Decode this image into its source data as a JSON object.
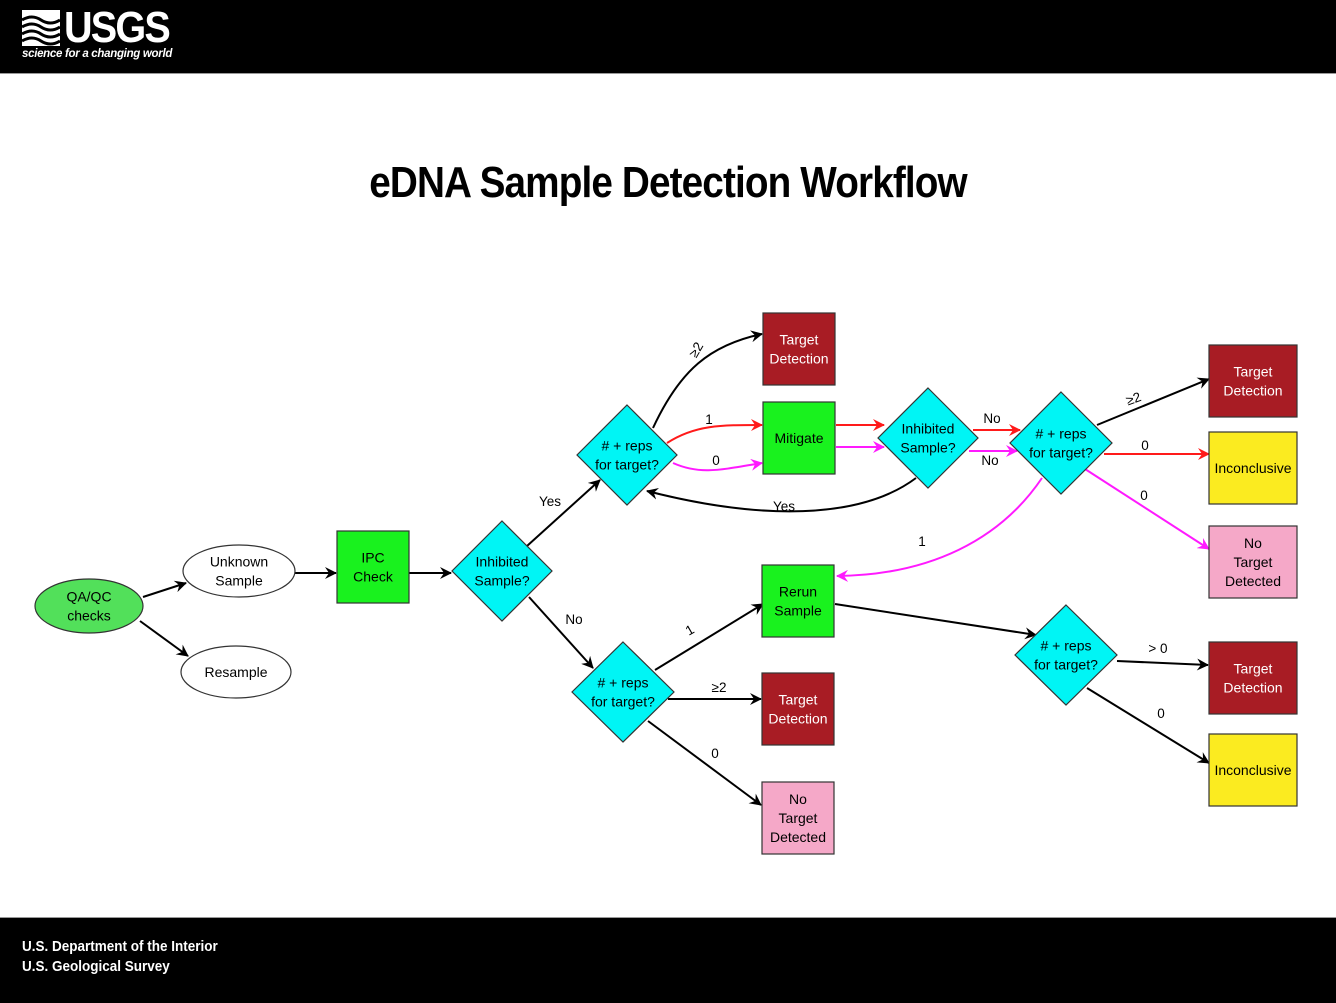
{
  "header": {
    "logo_text": "USGS",
    "tagline": "science for a changing world"
  },
  "title": "eDNA Sample Detection Workflow",
  "footer": {
    "line1": "U.S. Department of the Interior",
    "line2": "U.S. Geological Survey"
  },
  "colors": {
    "start": "#52e05a",
    "process": "#19f21e",
    "decision": "#00f5f5",
    "detection": "#a81c24",
    "inconclusive": "#fbeb20",
    "no_detection": "#f5a8c8",
    "edge_black": "#000000",
    "edge_red": "#ff1a1a",
    "edge_magenta": "#ff1aff"
  },
  "nodes": [
    {
      "id": "qaqc",
      "shape": "ellipse",
      "type": "start",
      "lines": [
        "QA/QC",
        "checks"
      ]
    },
    {
      "id": "unknown",
      "shape": "ellipse",
      "type": "plain",
      "lines": [
        "Unknown",
        "Sample"
      ]
    },
    {
      "id": "resample",
      "shape": "ellipse",
      "type": "plain",
      "lines": [
        "Resample"
      ]
    },
    {
      "id": "ipc",
      "shape": "rect",
      "type": "process",
      "lines": [
        "IPC",
        "Check"
      ]
    },
    {
      "id": "inhib1",
      "shape": "diamond",
      "type": "decision",
      "lines": [
        "Inhibited",
        "Sample?"
      ]
    },
    {
      "id": "reps1",
      "shape": "diamond",
      "type": "decision",
      "lines": [
        "# + reps",
        "for target?"
      ]
    },
    {
      "id": "td1",
      "shape": "rect",
      "type": "detection",
      "lines": [
        "Target",
        "Detection"
      ]
    },
    {
      "id": "mitigate",
      "shape": "rect",
      "type": "process",
      "lines": [
        "Mitigate"
      ]
    },
    {
      "id": "inhib2",
      "shape": "diamond",
      "type": "decision",
      "lines": [
        "Inhibited",
        "Sample?"
      ]
    },
    {
      "id": "reps2",
      "shape": "diamond",
      "type": "decision",
      "lines": [
        "# + reps",
        "for target?"
      ]
    },
    {
      "id": "td2",
      "shape": "rect",
      "type": "detection",
      "lines": [
        "Target",
        "Detection"
      ]
    },
    {
      "id": "inc1",
      "shape": "rect",
      "type": "inconclusive",
      "lines": [
        "Inconclusive"
      ]
    },
    {
      "id": "ntd1",
      "shape": "rect",
      "type": "no_detection",
      "lines": [
        "No",
        "Target",
        "Detected"
      ]
    },
    {
      "id": "reps3",
      "shape": "diamond",
      "type": "decision",
      "lines": [
        "# + reps",
        "for target?"
      ]
    },
    {
      "id": "rerun",
      "shape": "rect",
      "type": "process",
      "lines": [
        "Rerun",
        "Sample"
      ]
    },
    {
      "id": "td3",
      "shape": "rect",
      "type": "detection",
      "lines": [
        "Target",
        "Detection"
      ]
    },
    {
      "id": "ntd2",
      "shape": "rect",
      "type": "no_detection",
      "lines": [
        "No",
        "Target",
        "Detected"
      ]
    },
    {
      "id": "reps4",
      "shape": "diamond",
      "type": "decision",
      "lines": [
        "# + reps",
        "for target?"
      ]
    },
    {
      "id": "td4",
      "shape": "rect",
      "type": "detection",
      "lines": [
        "Target",
        "Detection"
      ]
    },
    {
      "id": "inc2",
      "shape": "rect",
      "type": "inconclusive",
      "lines": [
        "Inconclusive"
      ]
    }
  ],
  "edges": [
    {
      "from": "qaqc",
      "to": "unknown",
      "label": "",
      "color": "black"
    },
    {
      "from": "qaqc",
      "to": "resample",
      "label": "",
      "color": "black"
    },
    {
      "from": "unknown",
      "to": "ipc",
      "label": "",
      "color": "black"
    },
    {
      "from": "ipc",
      "to": "inhib1",
      "label": "",
      "color": "black"
    },
    {
      "from": "inhib1",
      "to": "reps1",
      "label": "Yes",
      "color": "black"
    },
    {
      "from": "inhib1",
      "to": "reps3",
      "label": "No",
      "color": "black"
    },
    {
      "from": "reps1",
      "to": "td1",
      "label": "≥2",
      "color": "black"
    },
    {
      "from": "reps1",
      "to": "mitigate",
      "label": "1",
      "color": "red"
    },
    {
      "from": "reps1",
      "to": "mitigate",
      "label": "0",
      "color": "magenta"
    },
    {
      "from": "mitigate",
      "to": "inhib2",
      "label": "",
      "color": "red"
    },
    {
      "from": "mitigate",
      "to": "inhib2",
      "label": "",
      "color": "magenta"
    },
    {
      "from": "inhib2",
      "to": "reps1",
      "label": "Yes",
      "color": "black"
    },
    {
      "from": "inhib2",
      "to": "reps2",
      "label": "No",
      "color": "red"
    },
    {
      "from": "inhib2",
      "to": "reps2",
      "label": "No",
      "color": "magenta"
    },
    {
      "from": "reps2",
      "to": "td2",
      "label": "≥2",
      "color": "black"
    },
    {
      "from": "reps2",
      "to": "inc1",
      "label": "0",
      "color": "red"
    },
    {
      "from": "reps2",
      "to": "ntd1",
      "label": "0",
      "color": "magenta"
    },
    {
      "from": "reps2",
      "to": "rerun",
      "label": "1",
      "color": "magenta"
    },
    {
      "from": "reps3",
      "to": "rerun",
      "label": "1",
      "color": "black"
    },
    {
      "from": "reps3",
      "to": "td3",
      "label": "≥2",
      "color": "black"
    },
    {
      "from": "reps3",
      "to": "ntd2",
      "label": "0",
      "color": "black"
    },
    {
      "from": "rerun",
      "to": "reps4",
      "label": "",
      "color": "black"
    },
    {
      "from": "reps4",
      "to": "td4",
      "label": "> 0",
      "color": "black"
    },
    {
      "from": "reps4",
      "to": "inc2",
      "label": "0",
      "color": "black"
    }
  ]
}
